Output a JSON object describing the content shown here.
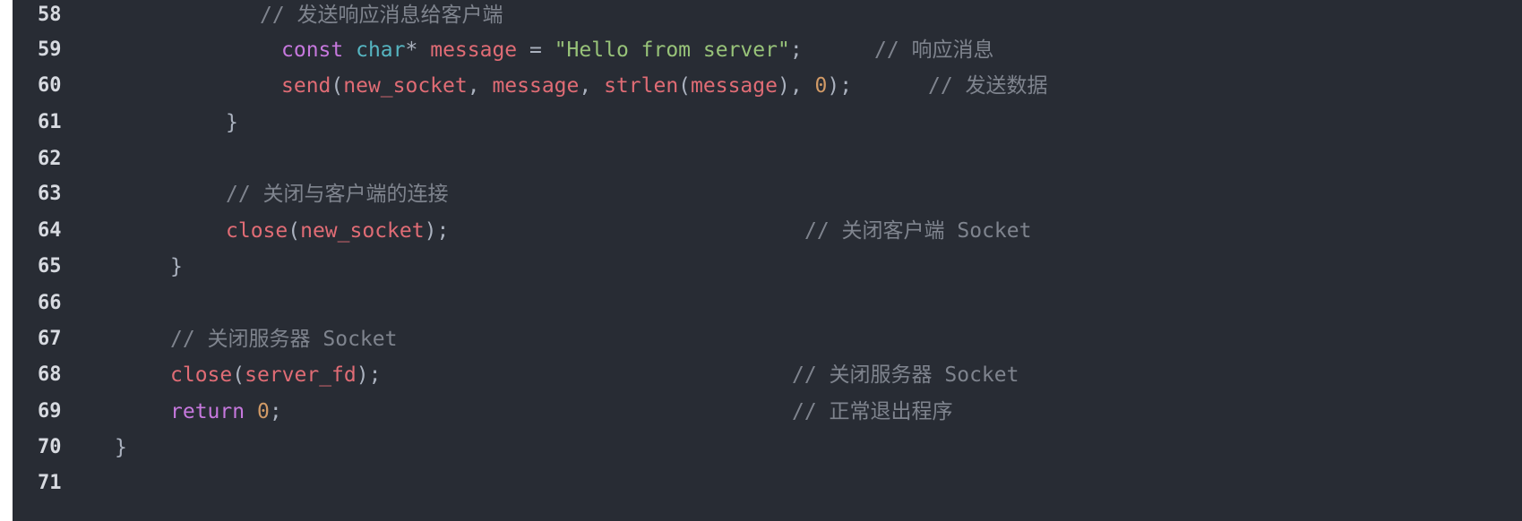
{
  "colors": {
    "background": "#282c34",
    "line_number": "#d7dae0",
    "comment": "#7f848e",
    "keyword": "#c678dd",
    "type": "#56b6c2",
    "identifier": "#e06c75",
    "string": "#98c379",
    "number": "#d19a66",
    "punctuation": "#abb2bf"
  },
  "lines": {
    "l58": {
      "num": "58",
      "comment": "// 发送响应消息给客户端"
    },
    "l59": {
      "num": "59",
      "const": "const",
      "char": "char",
      "star": "*",
      "message": "message",
      "eq": " = ",
      "str": "\"Hello from server\"",
      "semi": ";",
      "comment": "// 响应消息"
    },
    "l60": {
      "num": "60",
      "send": "send",
      "p1": "(",
      "new_socket": "new_socket",
      "c1": ", ",
      "message": "message",
      "c2": ", ",
      "strlen": "strlen",
      "p2": "(",
      "message2": "message",
      "p3": "), ",
      "zero": "0",
      "p4": ");",
      "comment": "// 发送数据"
    },
    "l61": {
      "num": "61",
      "brace": "}"
    },
    "l62": {
      "num": "62"
    },
    "l63": {
      "num": "63",
      "comment": "// 关闭与客户端的连接"
    },
    "l64": {
      "num": "64",
      "close": "close",
      "p1": "(",
      "new_socket": "new_socket",
      "p2": ");",
      "comment": "// 关闭客户端 Socket"
    },
    "l65": {
      "num": "65",
      "brace": "}"
    },
    "l66": {
      "num": "66"
    },
    "l67": {
      "num": "67",
      "comment": "// 关闭服务器 Socket"
    },
    "l68": {
      "num": "68",
      "close": "close",
      "p1": "(",
      "server_fd": "server_fd",
      "p2": ");",
      "comment": "// 关闭服务器 Socket"
    },
    "l69": {
      "num": "69",
      "ret": "return",
      "zero": "0",
      "semi": ";",
      "comment": "// 正常退出程序"
    },
    "l70": {
      "num": "70",
      "brace": "}"
    },
    "l71": {
      "num": "71"
    }
  }
}
